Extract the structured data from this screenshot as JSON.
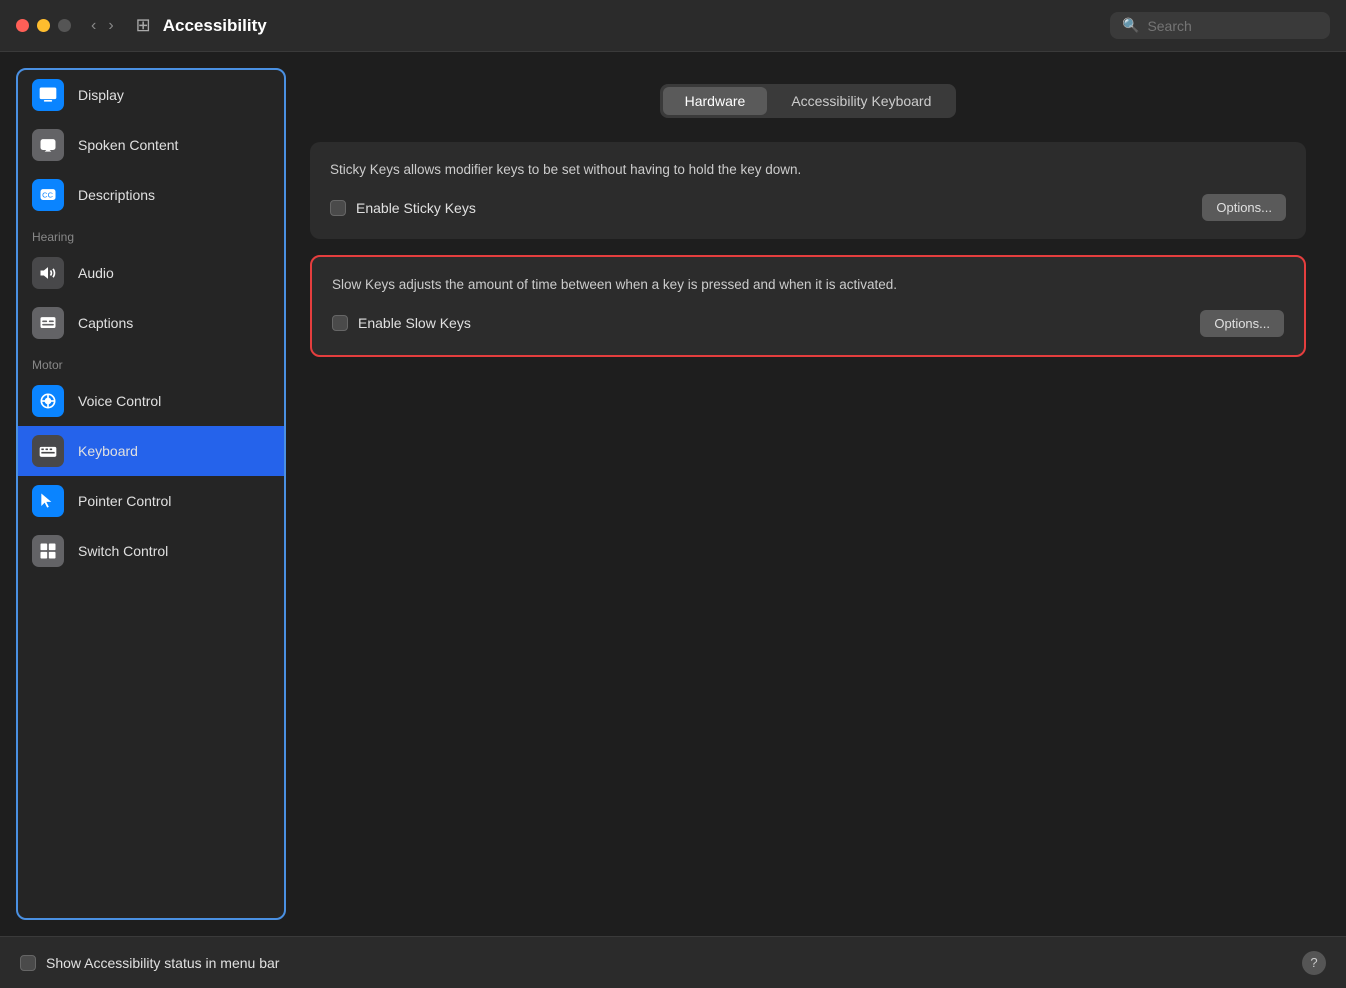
{
  "titlebar": {
    "title": "Accessibility",
    "search_placeholder": "Search"
  },
  "sidebar": {
    "items": [
      {
        "id": "display",
        "label": "Display",
        "icon_type": "blue",
        "icon": "🖥"
      },
      {
        "id": "spoken-content",
        "label": "Spoken Content",
        "icon_type": "gray",
        "icon": "💬"
      },
      {
        "id": "descriptions",
        "label": "Descriptions",
        "icon_type": "blue",
        "icon": "💬"
      }
    ],
    "sections": [
      {
        "label": "Hearing",
        "items": [
          {
            "id": "audio",
            "label": "Audio",
            "icon_type": "dark",
            "icon": "🔊"
          },
          {
            "id": "captions",
            "label": "Captions",
            "icon_type": "gray",
            "icon": "💬"
          }
        ]
      },
      {
        "label": "Motor",
        "items": [
          {
            "id": "voice-control",
            "label": "Voice Control",
            "icon_type": "blue",
            "icon": "⚙"
          },
          {
            "id": "keyboard",
            "label": "Keyboard",
            "icon_type": "dark",
            "icon": "⌨",
            "active": true
          },
          {
            "id": "pointer-control",
            "label": "Pointer Control",
            "icon_type": "blue",
            "icon": "↖"
          },
          {
            "id": "switch-control",
            "label": "Switch Control",
            "icon_type": "gray",
            "icon": "⊞"
          }
        ]
      }
    ]
  },
  "content": {
    "tabs": [
      {
        "id": "hardware",
        "label": "Hardware",
        "active": true
      },
      {
        "id": "accessibility-keyboard",
        "label": "Accessibility Keyboard",
        "active": false
      }
    ],
    "sticky_keys": {
      "description": "Sticky Keys allows modifier keys to be set without having to hold the key down.",
      "checkbox_label": "Enable Sticky Keys",
      "options_label": "Options...",
      "checked": false
    },
    "slow_keys": {
      "description": "Slow Keys adjusts the amount of time between when a key is pressed and when it is activated.",
      "checkbox_label": "Enable Slow Keys",
      "options_label": "Options...",
      "checked": false,
      "highlighted": true
    }
  },
  "bottom_bar": {
    "show_status_label": "Show Accessibility status in menu bar",
    "help_label": "?"
  }
}
